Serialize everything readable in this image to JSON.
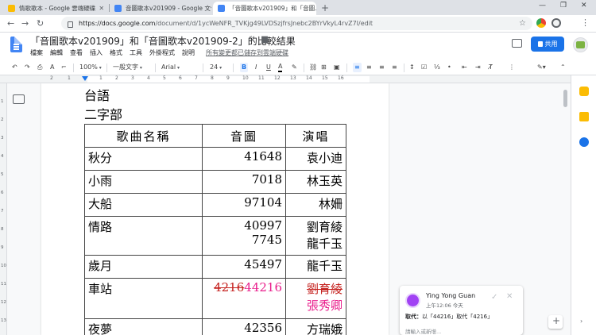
{
  "browser": {
    "tabs": [
      {
        "title": "情歌歌本 - Google 雲端硬碟",
        "color": "#fbbc04"
      },
      {
        "title": "音圖歌本v201909 - Google 文件",
        "color": "#4285f4"
      },
      {
        "title": "「音圖歌本v201909」和「音圖...",
        "color": "#4285f4"
      }
    ],
    "url_host": "https://docs.google.com",
    "url_path": "/document/d/1ycWeNFR_TVKjg49LVDSzjfrsJnebc2BYrVkyL4rvZ7I/edit"
  },
  "doc": {
    "title": "「音圖歌本v201909」和「音圖歌本v201909-2」的比較結果",
    "menus": [
      "檔案",
      "編輯",
      "查看",
      "插入",
      "格式",
      "工具",
      "外掛程式",
      "說明"
    ],
    "saved_status": "所有變更都已儲存到雲端硬碟",
    "share_label": "共用"
  },
  "toolbar": {
    "zoom": "100%",
    "style": "一般文字",
    "font": "Arial",
    "size": "24"
  },
  "ruler_numbers": [
    "2",
    "1",
    "1",
    "2",
    "3",
    "4",
    "5",
    "6",
    "7",
    "8",
    "9",
    "10",
    "11",
    "12",
    "13",
    "14",
    "15",
    "16"
  ],
  "vruler_numbers": [
    "1",
    "2",
    "3",
    "4",
    "5",
    "6",
    "7",
    "8",
    "9",
    "10",
    "11",
    "12",
    "13"
  ],
  "content": {
    "heading1": "台語",
    "heading2": "二字部",
    "table_headers": [
      "歌曲名稱",
      "音圖",
      "演唱"
    ],
    "rows": [
      {
        "name": "秋分",
        "num": "41648",
        "singer": "袁小迪"
      },
      {
        "name": "小雨",
        "num": "7018",
        "singer": "林玉英"
      },
      {
        "name": "大船",
        "num": "97104",
        "singer": "林姍"
      },
      {
        "name": "情路",
        "num": "40997",
        "num2": "7745",
        "singer": "劉育綾",
        "singer2": "龍千玉"
      },
      {
        "name": "歲月",
        "num": "45497",
        "singer": "龍千玉"
      },
      {
        "name": "車站",
        "num_deleted": "4216",
        "num_inserted": "44216",
        "singer_deleted": "劉育綾",
        "singer_inserted": "張秀卿"
      },
      {
        "name": "夜夢",
        "num": "42356",
        "singer": "方瑞娥"
      }
    ]
  },
  "comment": {
    "author": "Ying Yong Guan",
    "time": "上午12:06 今天",
    "body_label": "取代：",
    "body_text": "以「44216」取代「4216」",
    "reply_placeholder": "請輸入或新增..."
  }
}
